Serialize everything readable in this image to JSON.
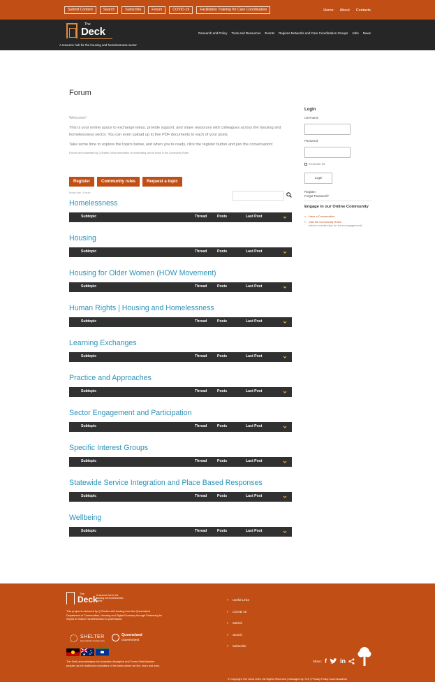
{
  "topbar": {
    "buttons": [
      "Submit Content",
      "Search",
      "Subscribe",
      "Forum",
      "COVID-19",
      "Facilitation Training for Care Coordinators"
    ],
    "right_links": [
      "Home",
      "About",
      "Contacts"
    ]
  },
  "header": {
    "logo_the": "The",
    "logo_deck": "Deck",
    "tagline": "A resource hub for the housing and homelessness sector",
    "nav": [
      "Research and Policy",
      "Tools and Resources",
      "Events",
      "Regions Networks and Care Coordination Groups",
      "Jobs",
      "News"
    ]
  },
  "main": {
    "title": "Forum",
    "welcome": "Welcome!",
    "intro1": "This is your online space to exchange ideas, provide support, and share resources with colleagues across the housing and homelessness sector. You can even upload up to five PDF documents to each of your posts.",
    "intro2": "Take some time to explore the topics below, and when you're ready, click the register button and join the conversation!",
    "moderation": "Forums are moderated by Q Shelter. More information on moderating can be found in the Community Rules.",
    "actions": [
      "Register",
      "Community rules",
      "Request a topic"
    ],
    "breadcrumb": "Home Nav › Forum",
    "columns": {
      "subtopic": "Subtopic",
      "thread": "Thread",
      "posts": "Posts",
      "last_post": "Last Post"
    },
    "categories": [
      "Homelessness",
      "Housing",
      "Housing for Older Women (HOW Movement)",
      "Human Rights | Housing and Homelessness",
      "Learning Exchanges",
      "Practice and Approaches",
      "Sector Engagement and Participation",
      "Specific Interest Groups",
      "Statewide Service Integration and Place Based Responses",
      "Wellbeing"
    ]
  },
  "sidebar": {
    "login_title": "Login",
    "username_label": "Username",
    "password_label": "Password",
    "remember_label": "Remember Me",
    "login_button": "Login",
    "register_link": "Register",
    "forgot_link": "Forgot Password?",
    "engage_title": "Engage in our Online Community",
    "link1": "Have a Conversation",
    "link2": "Visit the Community Rules",
    "link2_note": "(which includes tips for forum engagement)"
  },
  "footer": {
    "logo_the": "The",
    "logo_deck": "Deck",
    "tagline": "A resource hub for the housing and homelessness sector",
    "project_text": "This project is delivered by Q Shelter with funding from the Queensland Department of Communities, Housing and Digital Economy through Partnering for Impact to reduce homelessness in Queensland.",
    "shelter_name": "SHELTER",
    "shelter_sub": "Queensland's housing voice",
    "qld_name": "Queensland",
    "qld_gov": "Government",
    "acknowledgement": "The Deck acknowledges the Australian Aboriginal and Torres Strait Islander peoples as the traditional custodians of the lands where we live, learn and work.",
    "links": [
      "Useful Links",
      "COVID 19",
      "Submit",
      "Search",
      "Subscribe"
    ],
    "share_label": "Share:",
    "copyright": "© Copyright The Deck 2021, All Rights Reserved | Managed by Y2S | Privacy Policy and Disclaimer"
  },
  "colors": {
    "brand_orange": "#c14e14",
    "header_dark": "#262626",
    "category_blue": "#2c93b8",
    "bar_dark": "#313131",
    "chevron_yellow": "#f0b323"
  }
}
